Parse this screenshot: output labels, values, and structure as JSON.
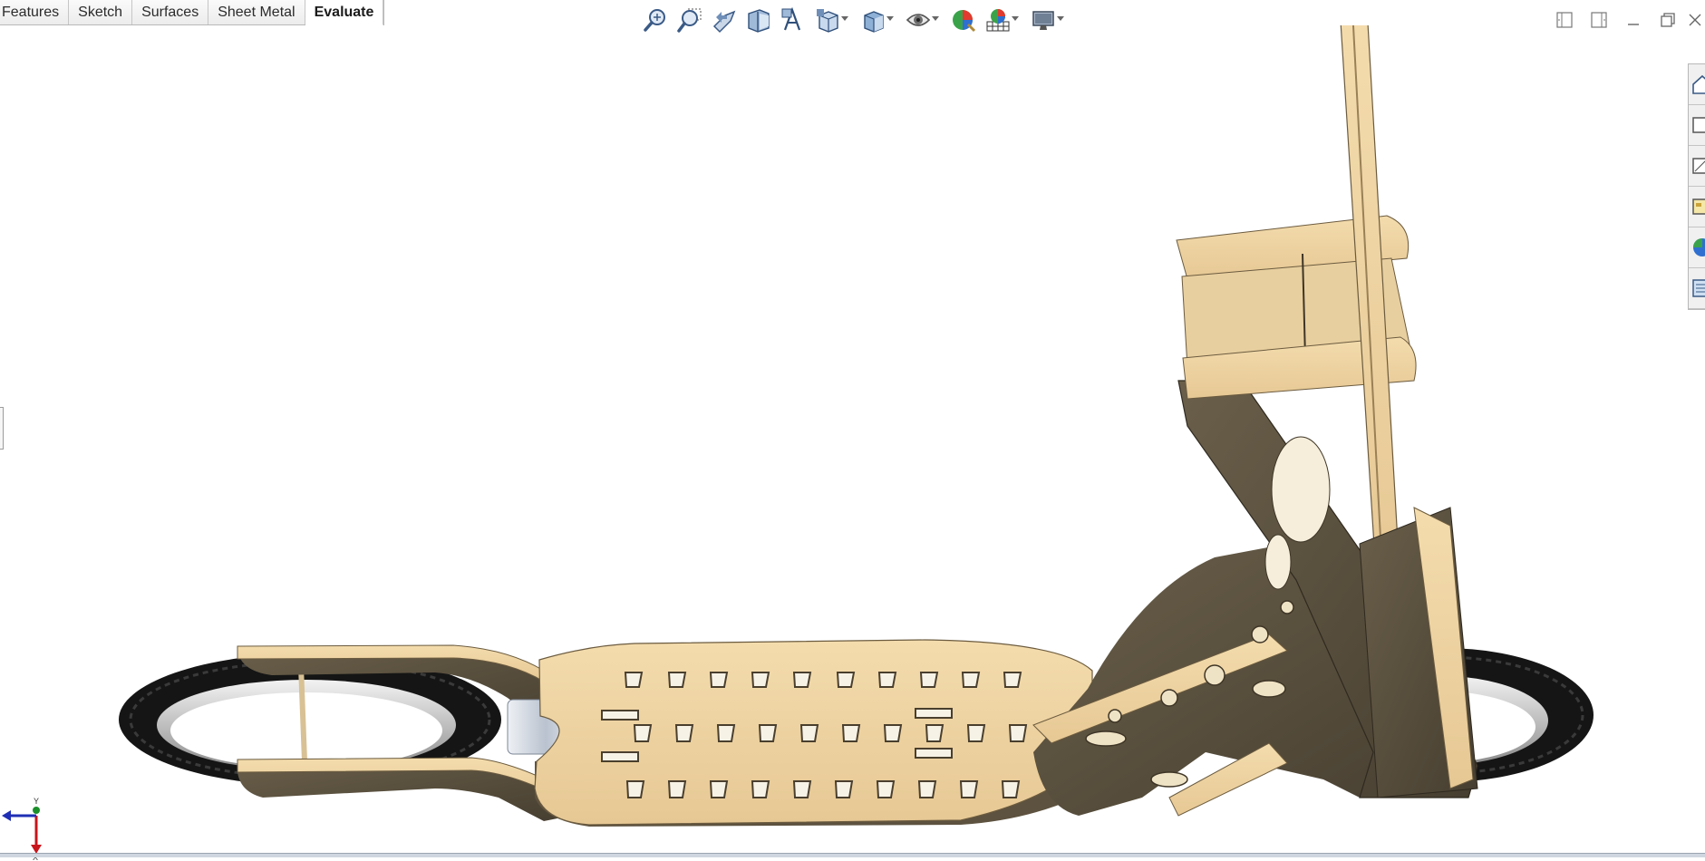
{
  "command_manager": {
    "tabs": [
      {
        "label": "Features",
        "active": false
      },
      {
        "label": "Sketch",
        "active": false
      },
      {
        "label": "Surfaces",
        "active": false
      },
      {
        "label": "Sheet Metal",
        "active": false
      },
      {
        "label": "Evaluate",
        "active": true
      }
    ]
  },
  "view_toolbar": {
    "tools": [
      "zoom-to-fit-icon",
      "zoom-to-area-icon",
      "previous-view-icon",
      "section-view-icon",
      "dynamic-annotation-views-icon",
      "view-orientation-icon",
      "display-style-icon",
      "hide-show-items-icon",
      "edit-appearance-icon",
      "apply-scene-icon",
      "view-settings-icon"
    ]
  },
  "window_controls": [
    "tile-left-icon",
    "tile-right-icon",
    "minimize-icon",
    "restore-icon",
    "close-icon"
  ],
  "task_pane": [
    "solidworks-resources-icon",
    "design-library-icon",
    "file-explorer-icon",
    "view-palette-icon",
    "appearances-scenes-icon",
    "custom-properties-icon"
  ],
  "triad": {
    "axes": [
      "Y",
      "X"
    ]
  },
  "colors": {
    "wood_light": "#ecd3a4",
    "wood_shade": "#5b5140",
    "tire": "#1f1f1f",
    "triad_x": "#c8141b",
    "triad_y": "#1a8f2a",
    "triad_z": "#1f2fb5"
  }
}
